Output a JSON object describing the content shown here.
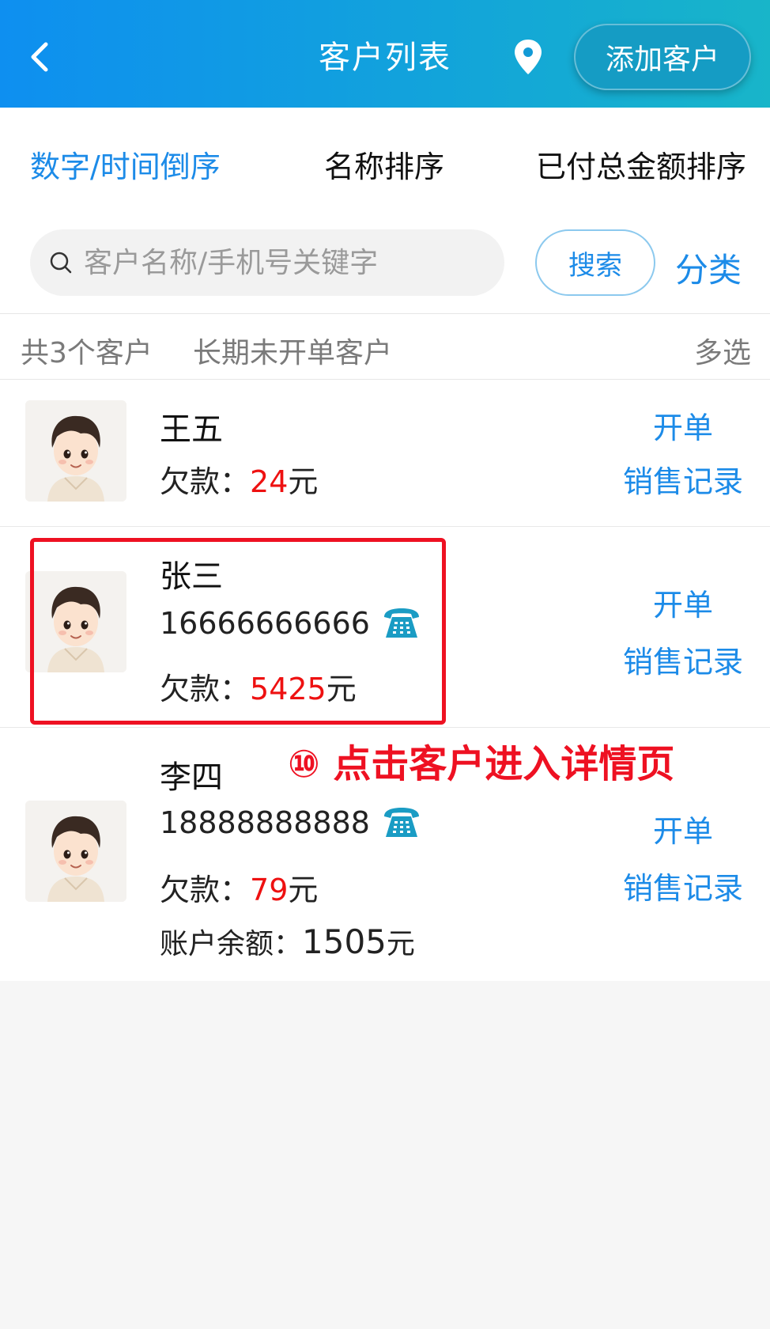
{
  "header": {
    "title": "客户列表",
    "add_button": "添加客户"
  },
  "sort_tabs": [
    {
      "label": "数字/时间倒序",
      "active": true
    },
    {
      "label": "名称排序",
      "active": false
    },
    {
      "label": "已付总金额排序",
      "active": false
    }
  ],
  "search": {
    "placeholder": "客户名称/手机号关键字",
    "value": "",
    "button": "搜索",
    "category": "分类"
  },
  "summary": {
    "count_text": "共3个客户",
    "inactive_link": "长期未开单客户",
    "multi_select": "多选"
  },
  "customers": [
    {
      "name": "王五",
      "phone": "",
      "debt_label": "欠款：",
      "debt": "24",
      "unit": "元",
      "order": "开单",
      "history": "销售记录"
    },
    {
      "name": "张三",
      "phone": "16666666666",
      "debt_label": "欠款：",
      "debt": "5425",
      "unit": "元",
      "order": "开单",
      "history": "销售记录"
    },
    {
      "name": "李四",
      "phone": "18888888888",
      "debt_label": "欠款：",
      "debt": "79",
      "unit": "元",
      "balance_label": "账户余额：",
      "balance": "1505",
      "order": "开单",
      "history": "销售记录"
    }
  ],
  "annotation": "⑩ 点击客户进入详情页",
  "colors": {
    "accent": "#1c8be8",
    "debt": "#ee1111",
    "annotation": "#ee1122",
    "header_start": "#0e8ff0",
    "header_end": "#18b5c9"
  }
}
